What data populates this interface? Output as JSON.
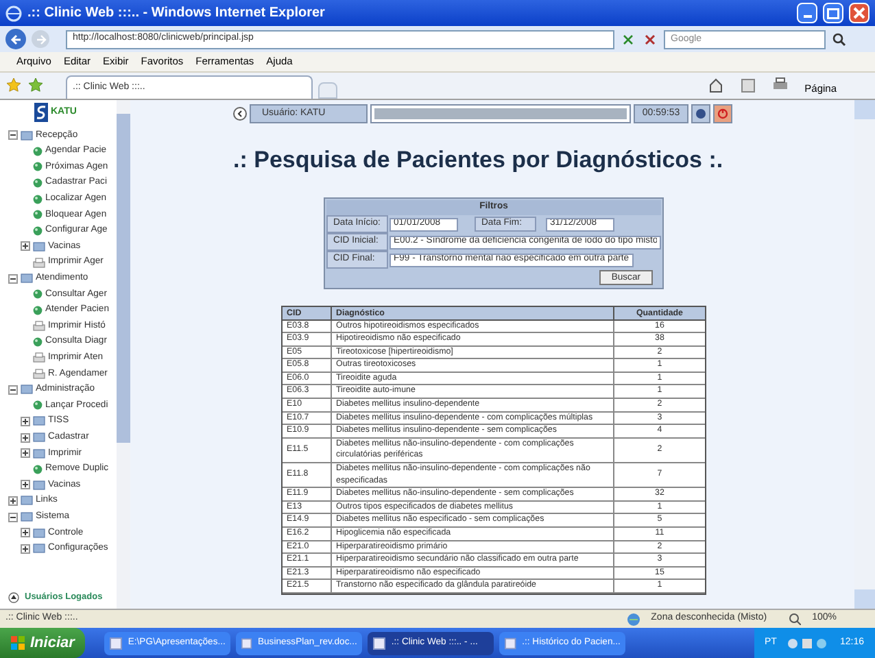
{
  "window": {
    "title": ".:: Clinic Web :::.. - Windows Internet Explorer"
  },
  "address_bar": {
    "url": "http://localhost:8080/clinicweb/principal.jsp",
    "search_placeholder": "Google"
  },
  "menu": [
    "Arquivo",
    "Editar",
    "Exibir",
    "Favoritos",
    "Ferramentas",
    "Ajuda"
  ],
  "tabs": [
    {
      "label": ".:: Clinic Web :::..",
      "selected": true
    }
  ],
  "toolbar": {
    "page_menu": "Página"
  },
  "sidebar": {
    "logo": "KATU",
    "tree": [
      {
        "kind": "group",
        "label": "Recepção",
        "expanded": true,
        "children": [
          {
            "kind": "link",
            "label": "Agendar Pacie"
          },
          {
            "kind": "link",
            "label": "Próximas Agen"
          },
          {
            "kind": "link",
            "label": "Cadastrar Paci"
          },
          {
            "kind": "link",
            "label": "Localizar Agen"
          },
          {
            "kind": "link",
            "label": "Bloquear Agen"
          },
          {
            "kind": "link",
            "label": "Configurar Age"
          },
          {
            "kind": "group",
            "label": "Vacinas",
            "expanded": false
          },
          {
            "kind": "print",
            "label": "Imprimir Ager"
          }
        ]
      },
      {
        "kind": "group",
        "label": "Atendimento",
        "expanded": true,
        "children": [
          {
            "kind": "link",
            "label": "Consultar Ager"
          },
          {
            "kind": "link",
            "label": "Atender Pacien"
          },
          {
            "kind": "print",
            "label": "Imprimir Histó"
          },
          {
            "kind": "link",
            "label": "Consulta Diagr"
          },
          {
            "kind": "print",
            "label": "Imprimir Aten"
          },
          {
            "kind": "print",
            "label": "R. Agendamer"
          }
        ]
      },
      {
        "kind": "group",
        "label": "Administração",
        "expanded": true,
        "children": [
          {
            "kind": "link",
            "label": "Lançar Procedi"
          },
          {
            "kind": "group",
            "label": "TISS",
            "expanded": false
          },
          {
            "kind": "group",
            "label": "Cadastrar",
            "expanded": false
          },
          {
            "kind": "group",
            "label": "Imprimir",
            "expanded": false
          },
          {
            "kind": "link",
            "label": "Remove Duplic"
          },
          {
            "kind": "group",
            "label": "Vacinas",
            "expanded": false
          }
        ]
      },
      {
        "kind": "group",
        "label": "Links",
        "expanded": false
      },
      {
        "kind": "group",
        "label": "Sistema",
        "expanded": true,
        "children": [
          {
            "kind": "group",
            "label": "Controle",
            "expanded": false
          },
          {
            "kind": "group",
            "label": "Configurações",
            "expanded": false
          }
        ]
      }
    ],
    "footer": "Usuários Logados"
  },
  "session_bar": {
    "user": "Usuário: KATU",
    "timer": "00:59:53"
  },
  "page_title": ".: Pesquisa de Pacientes por Diagnósticos :.",
  "filters": {
    "title": "Filtros",
    "start_label": "Data Início:",
    "start_value": "01/01/2008",
    "end_label": "Data Fim:",
    "end_value": "31/12/2008",
    "cid_start_label": "CID Inicial:",
    "cid_start_value": "E00.2 - Síndrome da deficiência congênita de iodo do tipo misto",
    "cid_end_label": "CID Final:",
    "cid_end_value": "F99 - Transtorno mental não especificado em outra parte",
    "search_button": "Buscar"
  },
  "table": {
    "columns": [
      "CID",
      "Diagnóstico",
      "Quantidade"
    ],
    "rows": [
      [
        "E03.8",
        "Outros hipotireoidismos especificados",
        "16"
      ],
      [
        "E03.9",
        "Hipotireoidismo não especificado",
        "38"
      ],
      [
        "E05",
        "Tireotoxicose [hipertireoidismo]",
        "2"
      ],
      [
        "E05.8",
        "Outras tireotoxicoses",
        "1"
      ],
      [
        "E06.0",
        "Tireoidite aguda",
        "1"
      ],
      [
        "E06.3",
        "Tireoidite auto-imune",
        "1"
      ],
      [
        "E10",
        "Diabetes mellitus insulino-dependente",
        "2"
      ],
      [
        "E10.7",
        "Diabetes mellitus insulino-dependente - com complicações múltiplas",
        "3"
      ],
      [
        "E10.9",
        "Diabetes mellitus insulino-dependente - sem complicações",
        "4"
      ],
      [
        "E11.5",
        "Diabetes mellitus não-insulino-dependente - com complicações circulatórias periféricas",
        "2"
      ],
      [
        "E11.8",
        "Diabetes mellitus não-insulino-dependente - com complicações não especificadas",
        "7"
      ],
      [
        "E11.9",
        "Diabetes mellitus não-insulino-dependente - sem complicações",
        "32"
      ],
      [
        "E13",
        "Outros tipos especificados de diabetes mellitus",
        "1"
      ],
      [
        "E14.9",
        "Diabetes mellitus não especificado - sem complicações",
        "5"
      ],
      [
        "E16.2",
        "Hipoglicemia não especificada",
        "11"
      ],
      [
        "E21.0",
        "Hiperparatireoidismo primário",
        "2"
      ],
      [
        "E21.1",
        "Hiperparatireoidismo secundário não classificado em outra parte",
        "3"
      ],
      [
        "E21.3",
        "Hiperparatireoidismo não especificado",
        "15"
      ],
      [
        "E21.5",
        "Transtorno não especificado da glândula paratireóide",
        "1"
      ]
    ]
  },
  "status_bar": {
    "text": ".:: Clinic Web :::..",
    "zone": "Zona desconhecida (Misto)",
    "zoom": "100%"
  },
  "taskbar": {
    "start": "Iniciar",
    "tasks": [
      {
        "label": "E:\\PG\\Apresentações...",
        "selected": false
      },
      {
        "label": "BusinessPlan_rev.doc...",
        "selected": false
      },
      {
        "label": ".:: Clinic Web :::.. - ...",
        "selected": true
      },
      {
        "label": ".:: Histórico do Pacien...",
        "selected": false
      }
    ],
    "language": "PT",
    "clock": "12:16"
  }
}
